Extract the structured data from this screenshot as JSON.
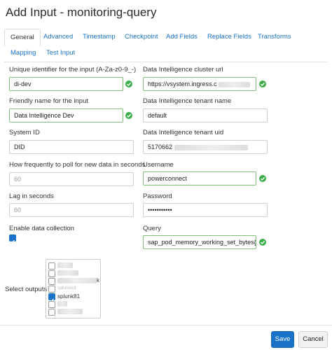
{
  "title": "Add Input - monitoring-query",
  "tabs": [
    "General",
    "Advanced",
    "Timestamp",
    "Checkpoint",
    "Add Fields",
    "Replace Fields",
    "Transforms",
    "Mapping",
    "Test Input"
  ],
  "left": {
    "uid_label": "Unique identifier for the input (A-Za-z0-9_-)",
    "uid_value": "di-dev",
    "friendly_label": "Friendly name for the input",
    "friendly_value": "Data Intelligence Dev",
    "system_id_label": "System ID",
    "system_id_value": "DID",
    "poll_label": "How frequently to poll for new data in seconds",
    "poll_placeholder": "60",
    "lag_label": "Lag in seconds",
    "lag_placeholder": "60",
    "enable_label": "Enable data collection",
    "outputs_label": "Select outputs"
  },
  "right": {
    "cluster_url_label": "Data Intelligence cluster url",
    "cluster_url_value": "https://vsystem.ingress.c",
    "tenant_name_label": "Data Intelligence tenant name",
    "tenant_name_value": "default",
    "tenant_uid_label": "Data Intelligence tenant uid",
    "tenant_uid_value": "5170662",
    "username_label": "Username",
    "username_value": "powerconnect",
    "password_label": "Password",
    "password_value": "•••••••••••",
    "query_label": "Query",
    "query_value": "sap_pod_memory_working_set_bytes{a"
  },
  "outputs": {
    "partial_text": "k",
    "partial_text2": "splunkicit",
    "checked_label": "splunk81"
  },
  "footer": {
    "save": "Save",
    "cancel": "Cancel"
  },
  "colors": {
    "accent": "#1a73c9",
    "valid": "#3cae4a"
  }
}
